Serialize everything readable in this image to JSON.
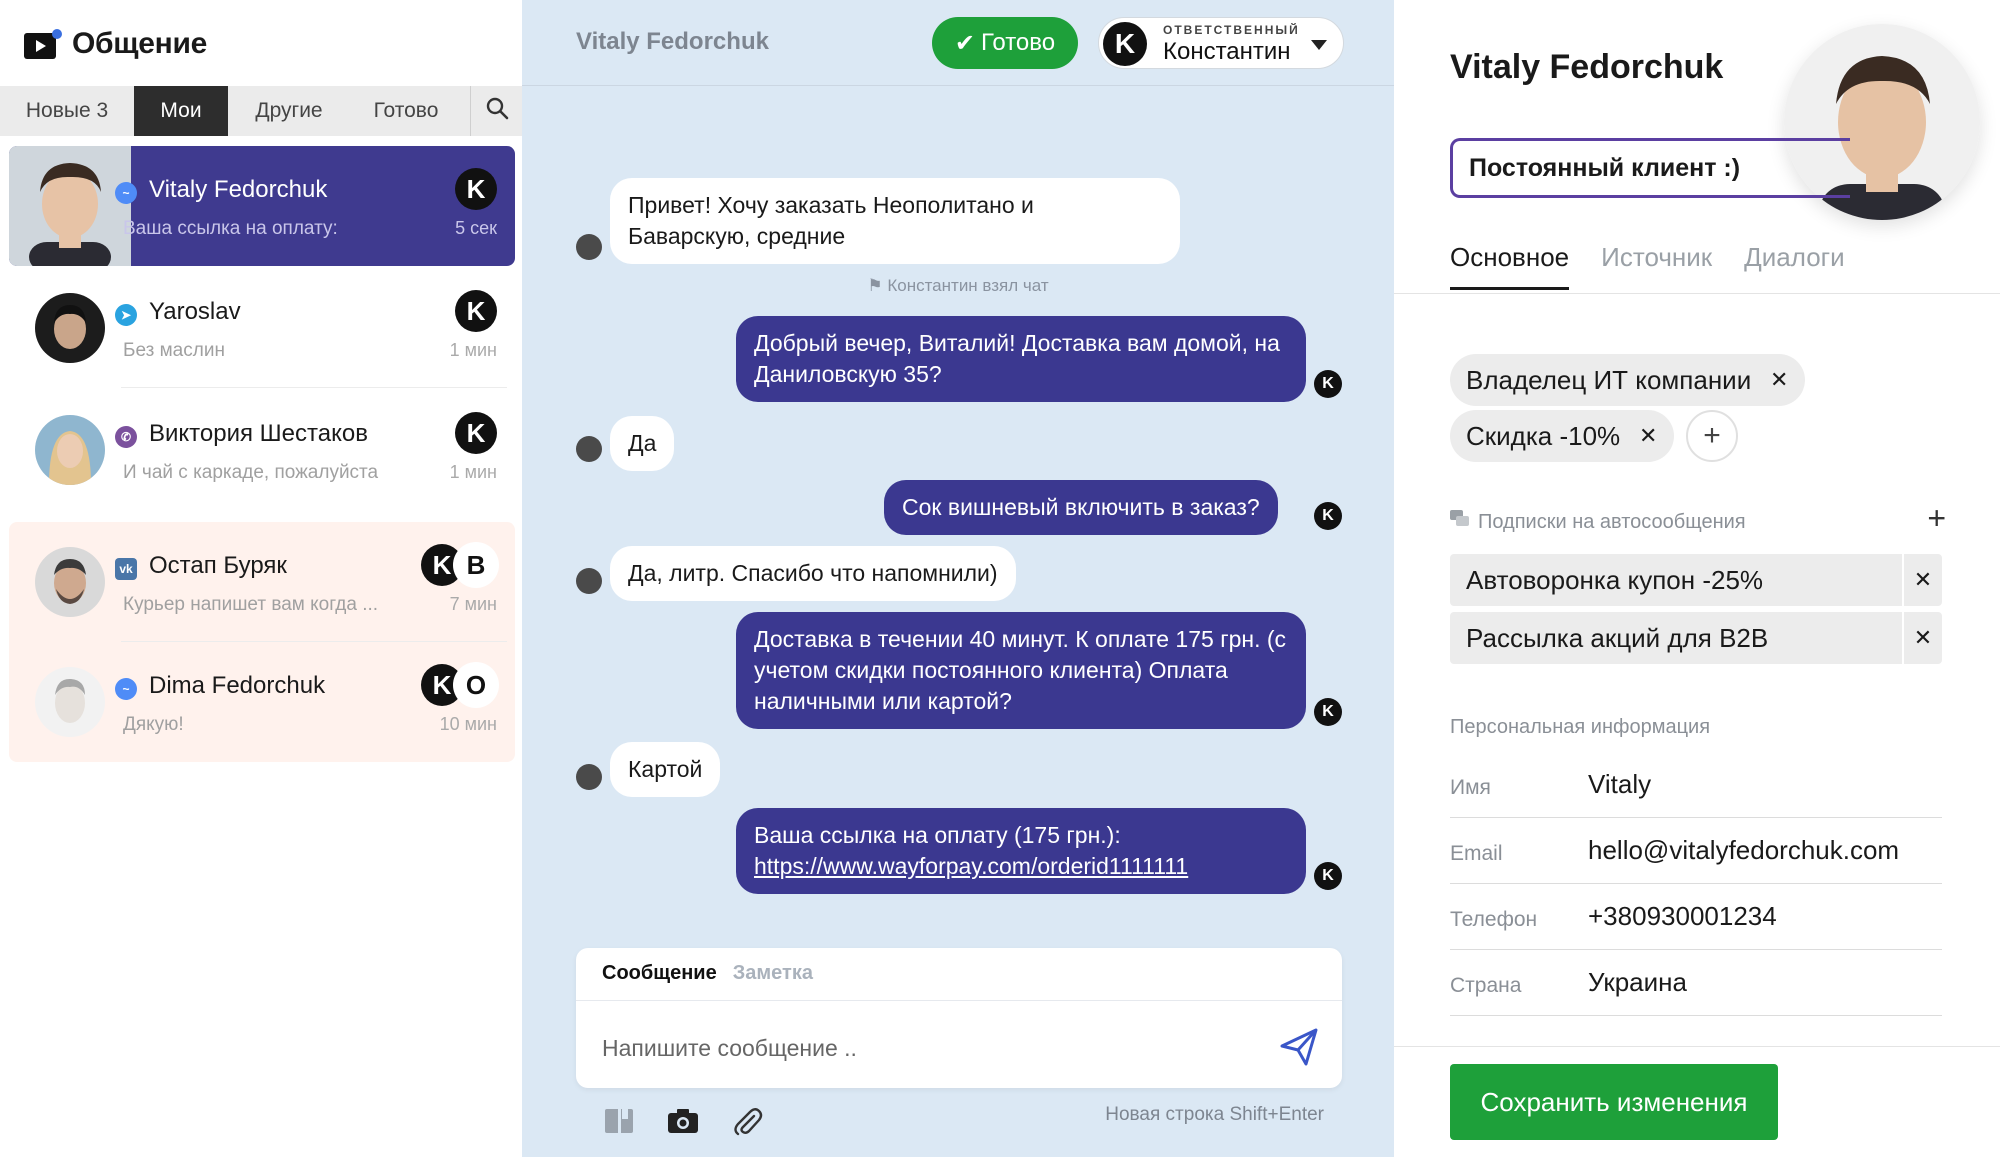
{
  "app": {
    "title": "Общение"
  },
  "sidebar": {
    "tabs": [
      {
        "label": "Новые 3"
      },
      {
        "label": "Мои"
      },
      {
        "label": "Другие"
      },
      {
        "label": "Готово"
      }
    ],
    "conversations": [
      {
        "name": "Vitaly Fedorchuk",
        "preview": "Ваша ссылка на оплату:",
        "time": "5 сек",
        "source": "messenger",
        "badges": [
          "K"
        ]
      },
      {
        "name": "Yaroslav",
        "preview": "Без маслин",
        "time": "1 мин",
        "source": "telegram",
        "badges": [
          "K"
        ]
      },
      {
        "name": "Виктория Шестаков",
        "preview": "И чай с каркаде, пожалуйста",
        "time": "1 мин",
        "source": "viber",
        "badges": [
          "K"
        ]
      },
      {
        "name": "Остап Буряк",
        "preview": "Курьер напишет вам когда ...",
        "time": "7 мин",
        "source": "vk",
        "badges": [
          "K",
          "B"
        ]
      },
      {
        "name": "Dima Fedorchuk",
        "preview": "Дякую!",
        "time": "10 мин",
        "source": "messenger",
        "badges": [
          "K",
          "O"
        ]
      }
    ]
  },
  "chat": {
    "title": "Vitaly Fedorchuk",
    "done_label": "Готово",
    "assignee_caption": "ОТВЕТСТВЕННЫЙ",
    "assignee_name": "Константин",
    "assignee_initial": "K",
    "system_message": "Константин взял чат",
    "messages": [
      {
        "text": "Привет! Хочу заказать Неополитано и Баварскую, средние"
      },
      {
        "text": "Добрый вечер, Виталий! Доставка вам домой, на Даниловскую 35?"
      },
      {
        "text": "Да"
      },
      {
        "text": "Сок вишневый включить в заказ?"
      },
      {
        "text": "Да, литр. Спасибо что напомнили)"
      },
      {
        "text": "Доставка в течении 40 минут. К оплате 175 грн. (с учетом скидки постоянного клиента) Оплата наличными или картой?"
      },
      {
        "text": "Картой"
      },
      {
        "text": "Ваша ссылка на оплату (175 грн.):",
        "link": "https://www.wayforpay.com/orderid1111111"
      }
    ],
    "composer": {
      "tab_message": "Сообщение",
      "tab_note": "Заметка",
      "placeholder": "Напишите сообщение ..",
      "hint": "Новая строка Shift+Enter"
    }
  },
  "profile": {
    "name": "Vitaly Fedorchuk",
    "status": "Постоянный клиент :)",
    "tabs": [
      {
        "label": "Основное"
      },
      {
        "label": "Источник"
      },
      {
        "label": "Диалоги"
      }
    ],
    "tags": [
      {
        "label": "Владелец ИТ компании"
      },
      {
        "label": "Скидка -10%"
      }
    ],
    "subscriptions_title": "Подписки на автосообщения",
    "subscriptions": [
      {
        "label": "Автоворонка купон -25%"
      },
      {
        "label": "Рассылка акций для B2B"
      }
    ],
    "personal_title": "Персональная информация",
    "fields": [
      {
        "label": "Имя",
        "value": "Vitaly"
      },
      {
        "label": "Email",
        "value": "hello@vitalyfedorchuk.com"
      },
      {
        "label": "Телефон",
        "value": "+380930001234"
      },
      {
        "label": "Страна",
        "value": "Украина"
      }
    ],
    "save_label": "Сохранить изменения"
  },
  "colors": {
    "accent_purple": "#3b3890",
    "success_green": "#1ea03a",
    "chat_background": "#dbe8f4",
    "brand_blue": "#3a6fe0"
  }
}
